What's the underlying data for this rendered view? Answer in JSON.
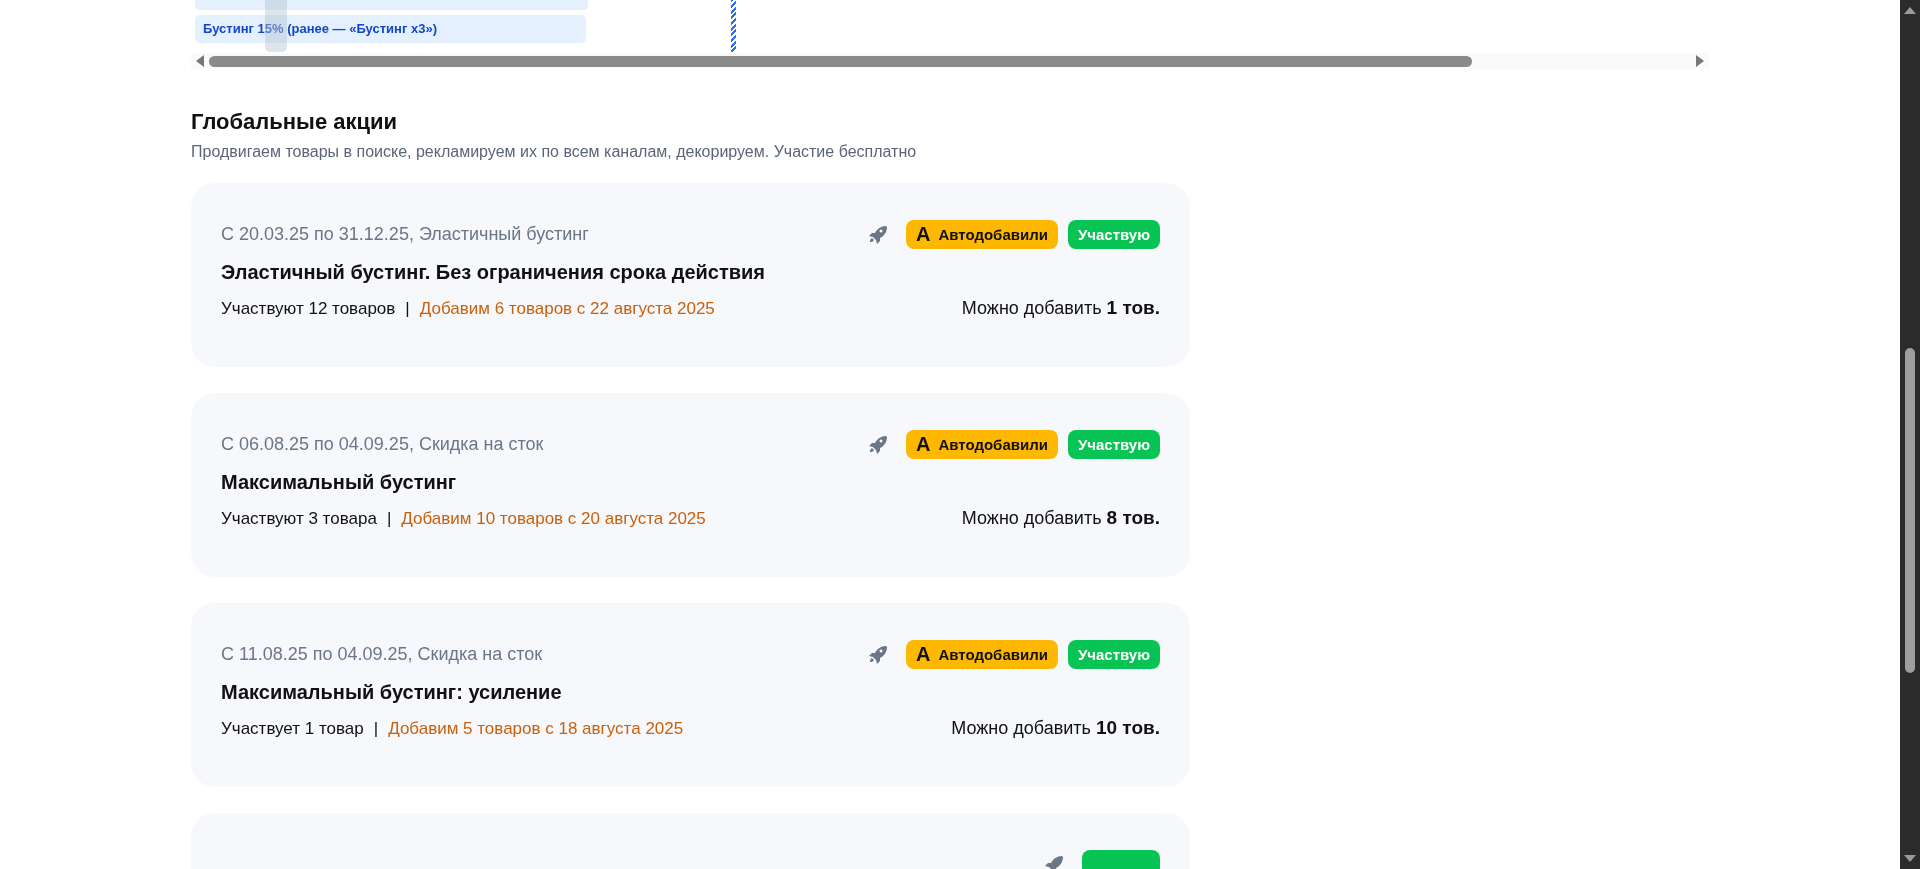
{
  "promo_bars": [
    {
      "label": "Бустинг 15% (ранее — «Бустинг x3»)"
    }
  ],
  "section": {
    "title": "Глобальные акции",
    "subtitle": "Продвигаем товары в поиске, рекламируем их по всем каналам, декорируем. Участие бесплатно"
  },
  "cards": [
    {
      "meta": "С 20.03.25 по 31.12.25, Эластичный бустинг",
      "title": "Эластичный бустинг. Без ограничения срока действия",
      "participants": "Участвуют 12 товаров",
      "separator": "|",
      "planned": "Добавим 6 товаров с 22 августа 2025",
      "can_add_label": "Можно добавить",
      "can_add_value": "1 тов.",
      "badges": [
        {
          "kind": "auto",
          "icon": "А",
          "label": "Автодобавили"
        },
        {
          "kind": "participating",
          "label": "Участвую"
        }
      ]
    },
    {
      "meta": "С 06.08.25 по 04.09.25, Скидка на сток",
      "title": "Максимальный бустинг",
      "participants": "Участвуют 3 товара",
      "separator": "|",
      "planned": "Добавим 10 товаров с 20 августа 2025",
      "can_add_label": "Можно добавить",
      "can_add_value": "8 тов.",
      "badges": [
        {
          "kind": "auto",
          "icon": "А",
          "label": "Автодобавили"
        },
        {
          "kind": "participating",
          "label": "Участвую"
        }
      ]
    },
    {
      "meta": "С 11.08.25 по 04.09.25, Скидка на сток",
      "title": "Максимальный бустинг: усиление",
      "participants": "Участвует 1 товар",
      "separator": "|",
      "planned": "Добавим 5 товаров с 18 августа 2025",
      "can_add_label": "Можно добавить",
      "can_add_value": "10 тов.",
      "badges": [
        {
          "kind": "auto",
          "icon": "А",
          "label": "Автодобавили"
        },
        {
          "kind": "participating",
          "label": "Участвую"
        }
      ]
    }
  ],
  "next_card": {
    "badges": [
      {
        "kind": "participating"
      }
    ]
  }
}
